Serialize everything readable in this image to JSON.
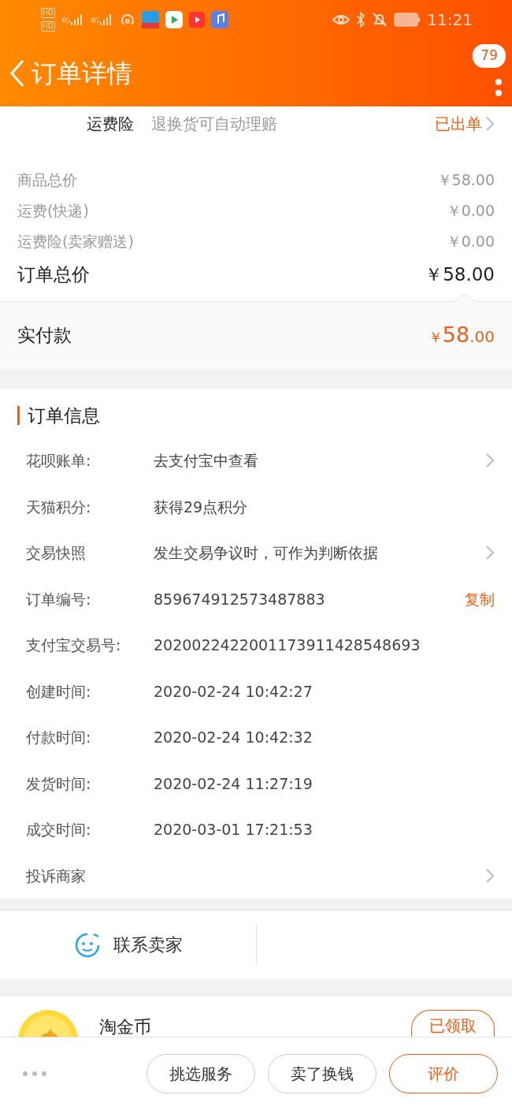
{
  "status_bar": {
    "hd_badges": [
      "HD",
      "HD"
    ],
    "network": [
      "4G",
      "4G"
    ],
    "time": "11:21"
  },
  "header": {
    "title": "订单详情",
    "message_count": "79"
  },
  "insurance": {
    "name": "运费险",
    "description": "退换货可自动理赔",
    "status": "已出单"
  },
  "price_rows": [
    {
      "label": "商品总价",
      "amount": "￥58.00",
      "kind": "minor"
    },
    {
      "label": "运费(快递)",
      "amount": "￥0.00",
      "kind": "minor"
    },
    {
      "label": "运费险(卖家赠送)",
      "amount": "￥0.00",
      "kind": "minor"
    },
    {
      "label": "订单总价",
      "amount": "￥58.00",
      "kind": "total"
    }
  ],
  "paid": {
    "label": "实付款",
    "currency": "￥",
    "integer": "58",
    "decimal": ".00"
  },
  "order_info": {
    "title": "订单信息",
    "rows": [
      {
        "label": "花呗账单:",
        "value": "去支付宝中查看",
        "kind": "link"
      },
      {
        "label": "天猫积分:",
        "value": "获得29点积分",
        "kind": "plain"
      },
      {
        "label": "交易快照",
        "value": "发生交易争议时，可作为判断依据",
        "kind": "link"
      },
      {
        "label": "订单编号:",
        "value": "859674912573487883",
        "kind": "copy",
        "action": "复制"
      },
      {
        "label": "支付宝交易号:",
        "value": "2020022422001173911428548693",
        "kind": "plain"
      },
      {
        "label": "创建时间:",
        "value": "2020-02-24 10:42:27",
        "kind": "plain"
      },
      {
        "label": "付款时间:",
        "value": "2020-02-24 10:42:32",
        "kind": "plain"
      },
      {
        "label": "发货时间:",
        "value": "2020-02-24 11:27:19",
        "kind": "plain"
      },
      {
        "label": "成交时间:",
        "value": "2020-03-01 17:21:53",
        "kind": "plain"
      },
      {
        "label": "投诉商家",
        "kind": "link"
      }
    ]
  },
  "contact": {
    "label": "联系卖家"
  },
  "coin": {
    "title": "淘金币",
    "button": "已领取"
  },
  "bottom_bar": {
    "buttons": [
      {
        "label": "挑选服务",
        "kind": "normal"
      },
      {
        "label": "卖了换钱",
        "kind": "normal"
      },
      {
        "label": "评价",
        "kind": "primary"
      }
    ]
  }
}
